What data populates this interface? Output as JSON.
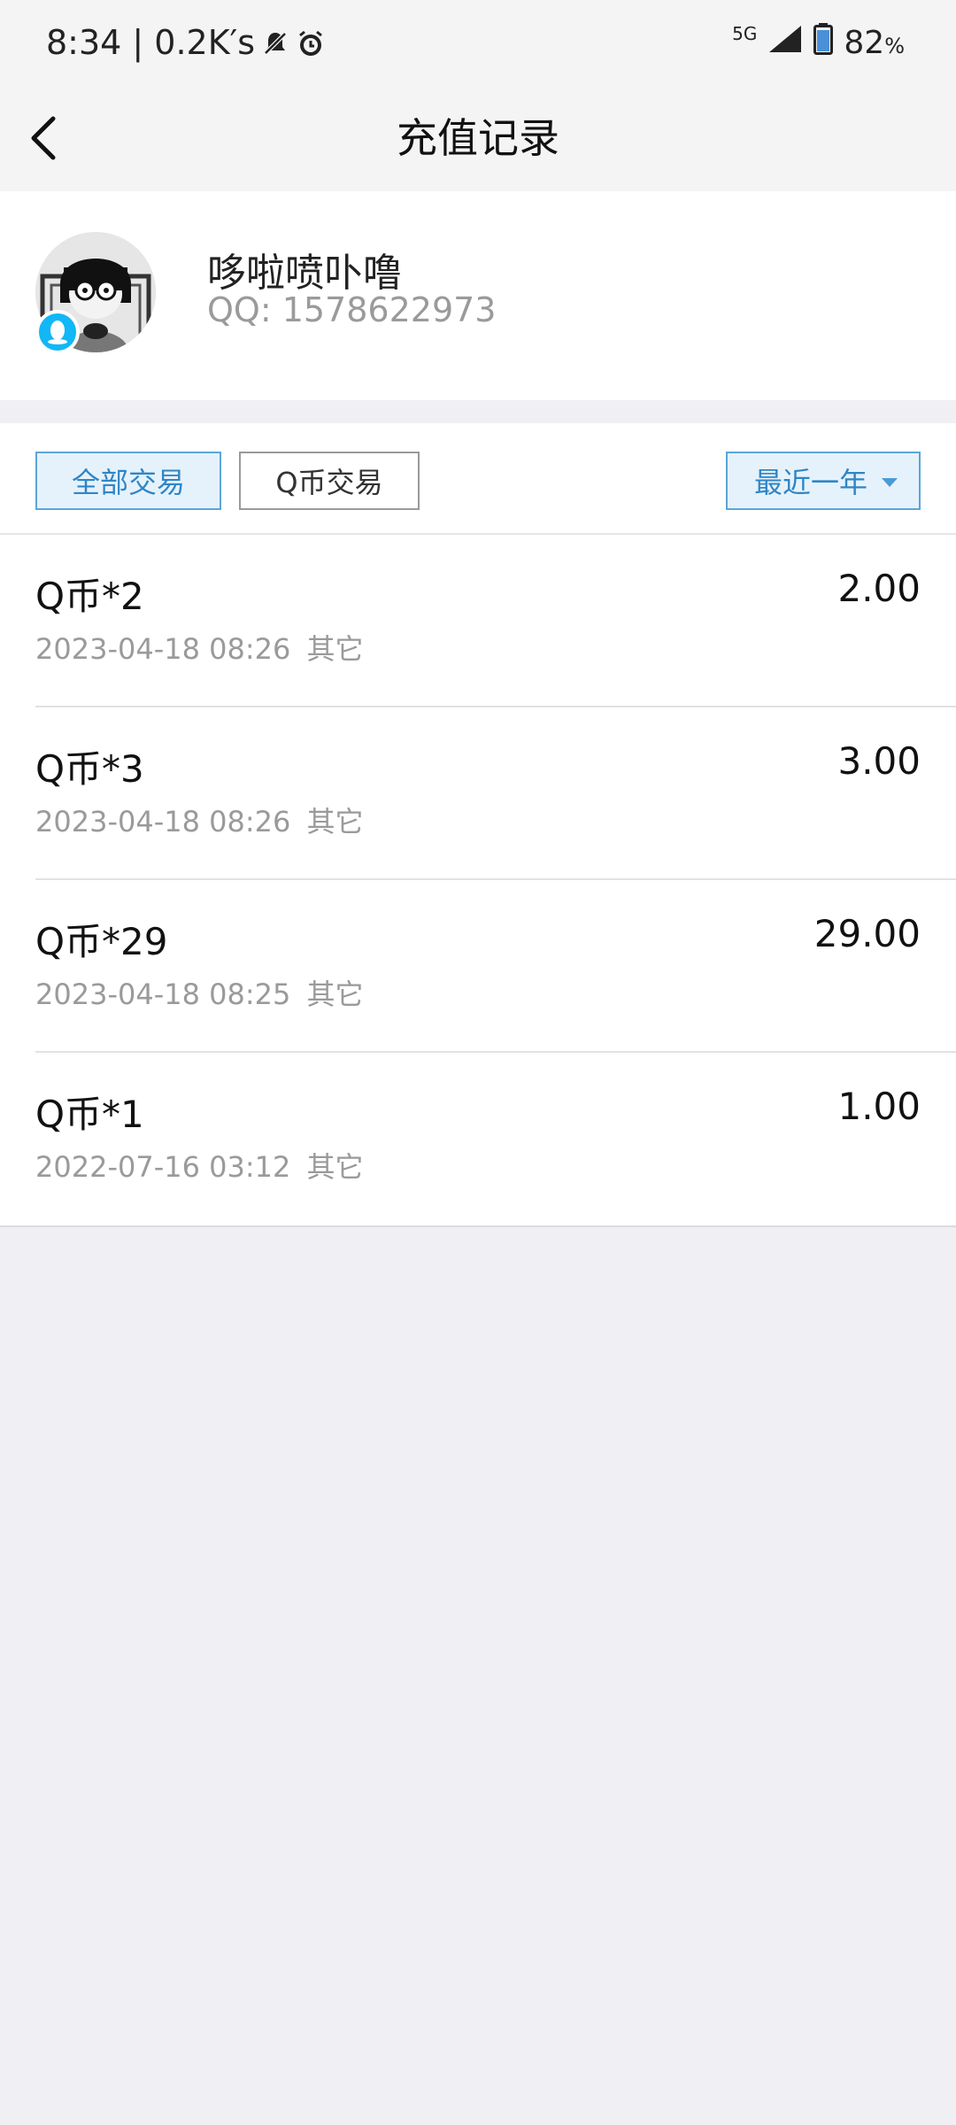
{
  "status_bar": {
    "time_speed": "8:34 | 0.2K′s",
    "network": "5G",
    "battery": "82",
    "battery_unit": "%"
  },
  "header": {
    "title": "充值记录"
  },
  "profile": {
    "nickname": "哆啦喷卟噜",
    "qq_number": "QQ: 1578622973"
  },
  "filters": {
    "all": "全部交易",
    "qcoin": "Q币交易",
    "range": "最近一年"
  },
  "transactions": [
    {
      "title": "Q币*2",
      "amount": "2.00",
      "datetime": "2023-04-18 08:26",
      "category": "其它"
    },
    {
      "title": "Q币*3",
      "amount": "3.00",
      "datetime": "2023-04-18 08:26",
      "category": "其它"
    },
    {
      "title": "Q币*29",
      "amount": "29.00",
      "datetime": "2023-04-18 08:25",
      "category": "其它"
    },
    {
      "title": "Q币*1",
      "amount": "1.00",
      "datetime": "2022-07-16 03:12",
      "category": "其它"
    }
  ],
  "colors": {
    "accent": "#2f86c6",
    "qq_badge": "#12b7f5",
    "page_bg": "#efeff4"
  }
}
